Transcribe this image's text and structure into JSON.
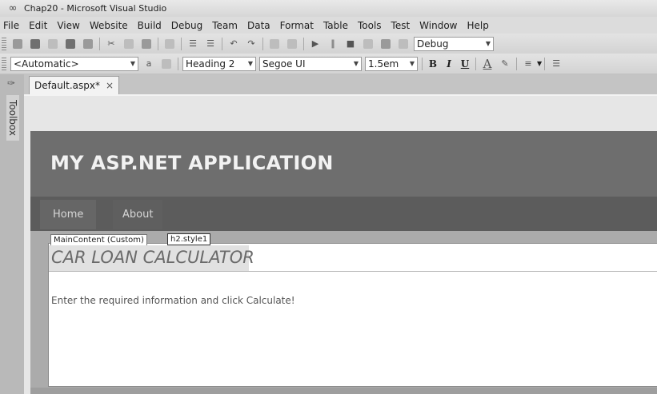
{
  "window": {
    "title": "Chap20 - Microsoft Visual Studio"
  },
  "menu": [
    "File",
    "Edit",
    "View",
    "Website",
    "Build",
    "Debug",
    "Team",
    "Data",
    "Format",
    "Table",
    "Tools",
    "Test",
    "Window",
    "Help"
  ],
  "toolbar1": {
    "config": "Debug"
  },
  "toolbar2": {
    "target": "<Automatic>",
    "block_format": "Heading 2",
    "font": "Segoe UI",
    "size": "1.5em",
    "bold": "B",
    "italic": "I",
    "underline": "U"
  },
  "toolbox": {
    "label": "Toolbox"
  },
  "tab": {
    "label": "Default.aspx*",
    "close": "×"
  },
  "page": {
    "app_title": "MY ASP.NET APPLICATION",
    "nav": [
      "Home",
      "About"
    ],
    "content_label": "MainContent (Custom)",
    "style_label": "h2.style1",
    "heading": "CAR LOAN CALCULATOR",
    "body": "Enter the required information and click Calculate!"
  },
  "icons": [
    "vs-logo-icon",
    "new-project-icon",
    "open-icon",
    "add-item-icon",
    "save-icon",
    "save-all-icon",
    "cut-icon",
    "copy-icon",
    "paste-icon",
    "find-icon",
    "comment-icon",
    "uncomment-icon",
    "undo-icon",
    "redo-icon",
    "navigate-icon",
    "start-icon",
    "pause-icon",
    "stop-icon",
    "font-color-icon",
    "highlight-icon",
    "align-icon",
    "list-icon",
    "pin-icon",
    "close-icon"
  ]
}
